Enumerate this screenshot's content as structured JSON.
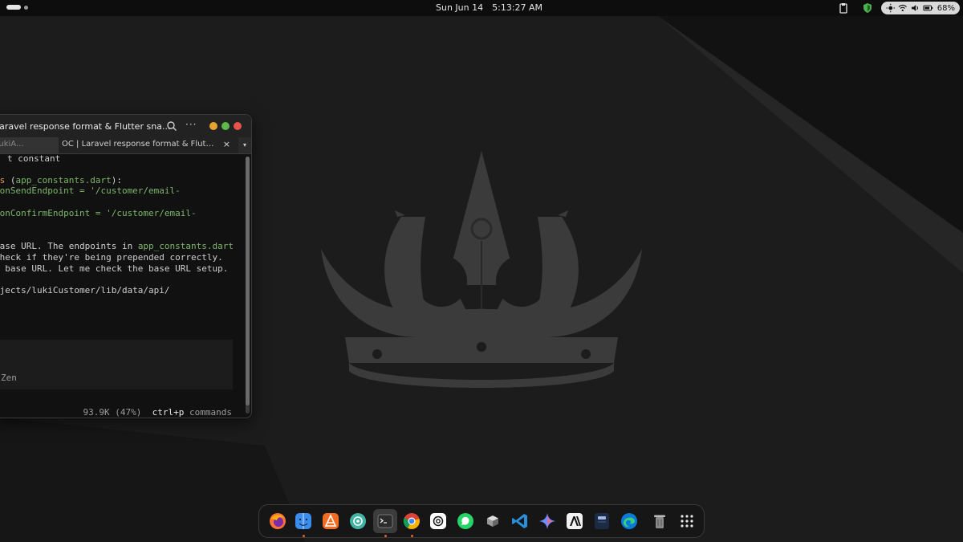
{
  "topbar": {
    "date": "Sun Jun 14",
    "time": "5:13:27 AM",
    "battery_level": "68%",
    "icons": [
      "clipboard-icon",
      "shield-icon",
      "brightness-icon",
      "wifi-icon",
      "volume-icon",
      "battery-icon"
    ]
  },
  "terminal": {
    "window_title": "Laravel response format & Flutter sna...",
    "tabs": [
      {
        "label": "LukiA..."
      },
      {
        "label": "OC | Laravel response format & Flutter sna..."
      }
    ],
    "tab_close_glyph": "×",
    "tab_dropdown_glyph": "▾",
    "menu_glyph": "···",
    "lines": [
      {
        "segments": [
          {
            "t": "t constant",
            "c": "white"
          }
        ]
      },
      {
        "segments": [
          {
            "t": "ts",
            "c": "orange"
          },
          {
            "t": " (",
            "c": "white"
          },
          {
            "t": "app_constants.dart",
            "c": "green"
          },
          {
            "t": "):",
            "c": "white"
          }
        ]
      },
      {
        "segments": [
          {
            "t": "ionSendEndpoint = '/customer/email-",
            "c": "green"
          }
        ]
      },
      {
        "segments": [
          {
            "t": "ionConfirmEndpoint = '/customer/email-",
            "c": "green"
          }
        ]
      },
      {
        "segments": [
          {
            "t": "base URL. The endpoints in ",
            "c": "white"
          },
          {
            "t": "app_constants.dart",
            "c": "green"
          }
        ]
      },
      {
        "segments": [
          {
            "t": "check if they're being prepended correctly.",
            "c": "white"
          }
        ]
      },
      {
        "segments": [
          {
            "t": "a base URL. Let me check the base URL setup.",
            "c": "white"
          }
        ]
      },
      {
        "segments": [
          {
            "t": "ojects/lukiCustomer/lib/data/api/",
            "c": "white"
          }
        ]
      }
    ],
    "input_hint": "Zen",
    "status_tokens": "93.9K (47%)",
    "status_key": "ctrl+p",
    "status_cmd": "commands"
  },
  "dock": {
    "items": [
      {
        "name": "firefox-icon",
        "running": false
      },
      {
        "name": "finder-icon",
        "running": true
      },
      {
        "name": "app-store-icon",
        "running": false
      },
      {
        "name": "chatgpt-teal-icon",
        "running": false
      },
      {
        "name": "terminal-icon",
        "running": true,
        "active": true
      },
      {
        "name": "chrome-icon",
        "running": true
      },
      {
        "name": "openai-icon",
        "running": false
      },
      {
        "name": "whatsapp-icon",
        "running": false
      },
      {
        "name": "box-icon",
        "running": false
      },
      {
        "name": "vscode-icon",
        "running": false
      },
      {
        "name": "gemini-icon",
        "running": false
      },
      {
        "name": "anthropic-icon",
        "running": false
      },
      {
        "name": "notes-icon",
        "running": false
      },
      {
        "name": "edge-icon",
        "running": false
      },
      {
        "name": "trash-icon",
        "running": false
      },
      {
        "name": "app-grid-icon",
        "running": false
      }
    ]
  },
  "colors": {
    "wallpaper": "#1c1c1c",
    "crown": "#3b3b3b",
    "accent_orange": "#e89a5a",
    "accent_green": "#7cb66a"
  }
}
